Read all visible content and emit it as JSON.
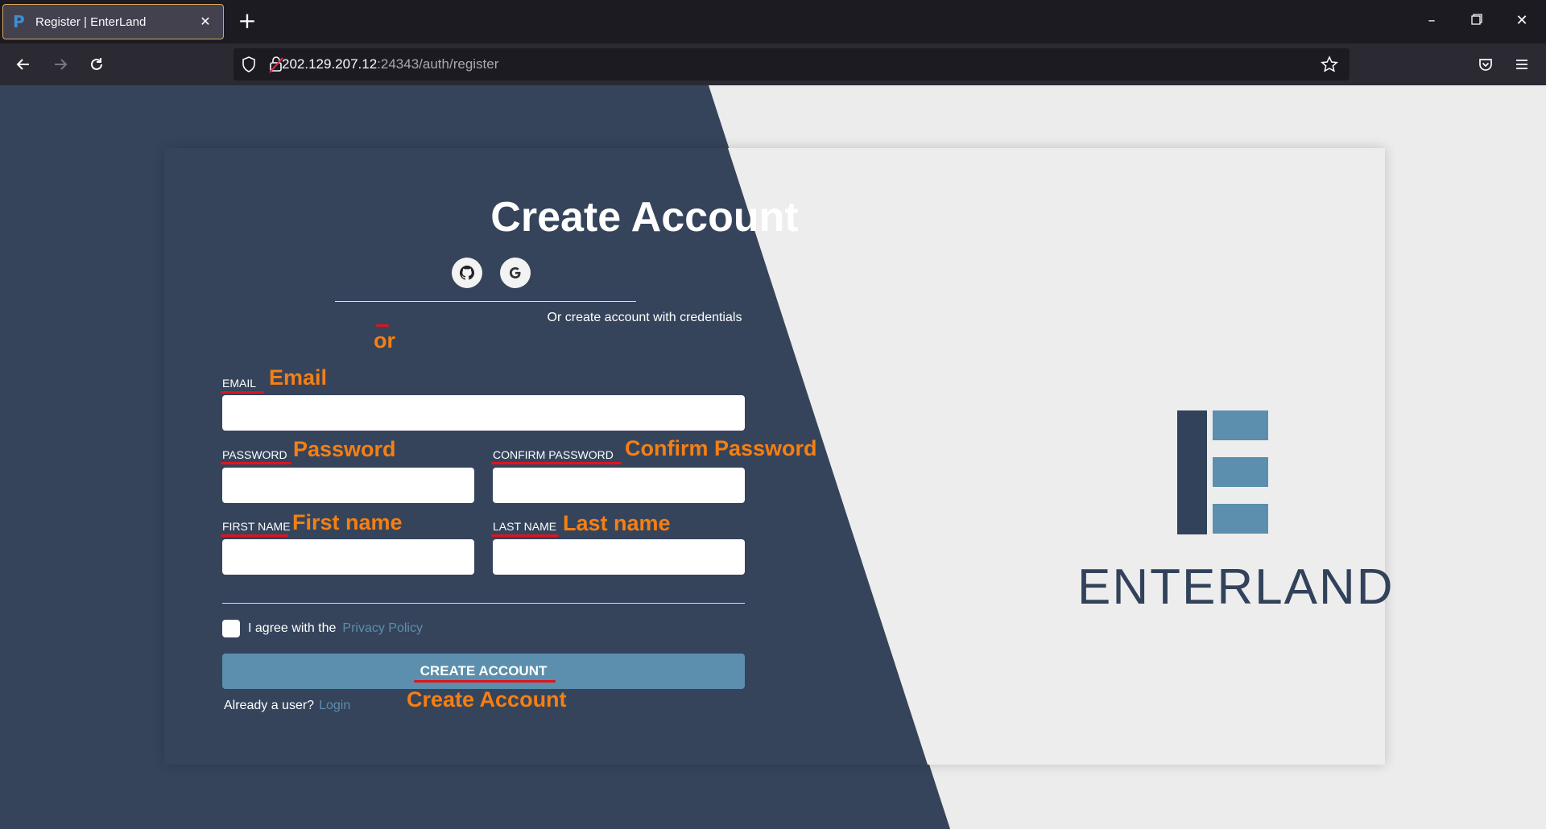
{
  "browser": {
    "tab_title": "Register | EnterLand",
    "url_host": "202.129.207.12",
    "url_rest": ":24343/auth/register"
  },
  "form": {
    "title": "Create Account",
    "social": [
      "github-icon",
      "google-icon"
    ],
    "or_text": "Or create account with credentials",
    "email_label": "EMAIL",
    "password_label": "PASSWORD",
    "confirm_password_label": "CONFIRM PASSWORD",
    "first_name_label": "FIRST NAME",
    "last_name_label": "LAST NAME",
    "agree_text": "I agree with the",
    "privacy_link": "Privacy Policy",
    "submit_label": "CREATE ACCOUNT",
    "already_text": "Already a user?",
    "login_link": "Login"
  },
  "annotations": {
    "or": "or",
    "email": "Email",
    "password": "Password",
    "confirm_password": "Confirm Password",
    "first_name": "First name",
    "last_name": "Last name",
    "create_account": "Create Account"
  },
  "brand": {
    "logo_text": "ENTERLAND"
  },
  "colors": {
    "panel_dark": "#35445b",
    "accent": "#5b8fad",
    "annotation": "#f57f13",
    "underline": "#e0141c"
  }
}
